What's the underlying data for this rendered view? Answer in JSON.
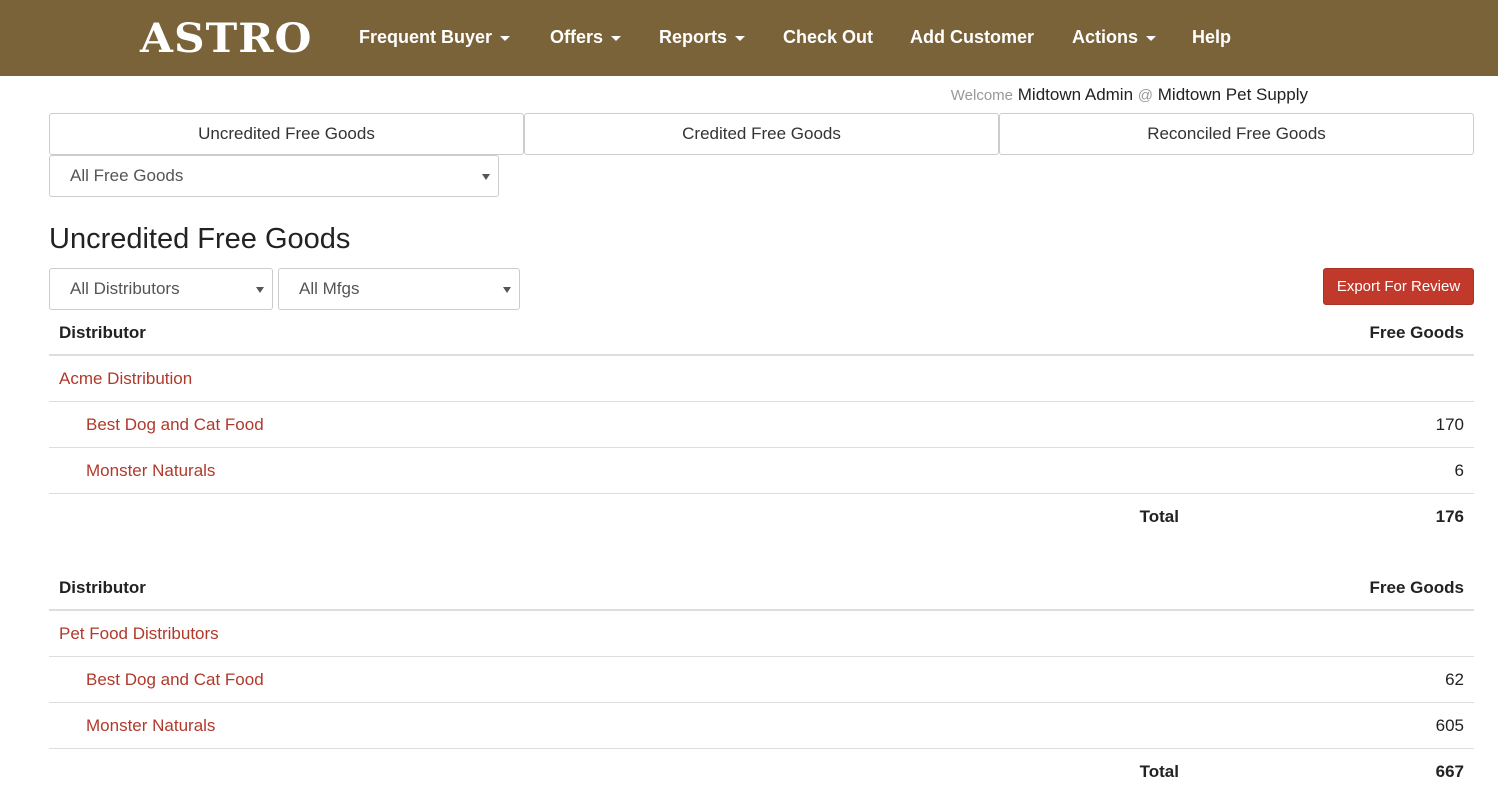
{
  "navbar": {
    "brand": "ASTRO",
    "items": [
      {
        "label": "Frequent Buyer",
        "dropdown": true
      },
      {
        "label": "Offers",
        "dropdown": true
      },
      {
        "label": "Reports",
        "dropdown": true
      },
      {
        "label": "Check Out",
        "dropdown": false
      },
      {
        "label": "Add Customer",
        "dropdown": false
      },
      {
        "label": "Actions",
        "dropdown": true
      },
      {
        "label": "Help",
        "dropdown": false
      }
    ]
  },
  "welcome": {
    "prefix": "Welcome",
    "user": "Midtown Admin",
    "at": "@",
    "store": "Midtown Pet Supply"
  },
  "tabs": [
    {
      "label": "Uncredited Free Goods",
      "active": true
    },
    {
      "label": "Credited Free Goods",
      "active": false
    },
    {
      "label": "Reconciled Free Goods",
      "active": false
    }
  ],
  "filters": {
    "goods_type": "All Free Goods",
    "distributor": "All Distributors",
    "mfg": "All Mfgs"
  },
  "page_title": "Uncredited Free Goods",
  "export_label": "Export For Review",
  "colors": {
    "navbar_bg": "#7a6239",
    "link": "#b0392b",
    "export_button": "#c0392b"
  },
  "tables": [
    {
      "header_distributor": "Distributor",
      "header_free_goods": "Free Goods",
      "distributor": "Acme Distribution",
      "rows": [
        {
          "name": "Best Dog and Cat Food",
          "value": "170"
        },
        {
          "name": "Monster Naturals",
          "value": "6"
        }
      ],
      "total_label": "Total",
      "total_value": "176"
    },
    {
      "header_distributor": "Distributor",
      "header_free_goods": "Free Goods",
      "distributor": "Pet Food Distributors",
      "rows": [
        {
          "name": "Best Dog and Cat Food",
          "value": "62"
        },
        {
          "name": "Monster Naturals",
          "value": "605"
        }
      ],
      "total_label": "Total",
      "total_value": "667"
    }
  ]
}
